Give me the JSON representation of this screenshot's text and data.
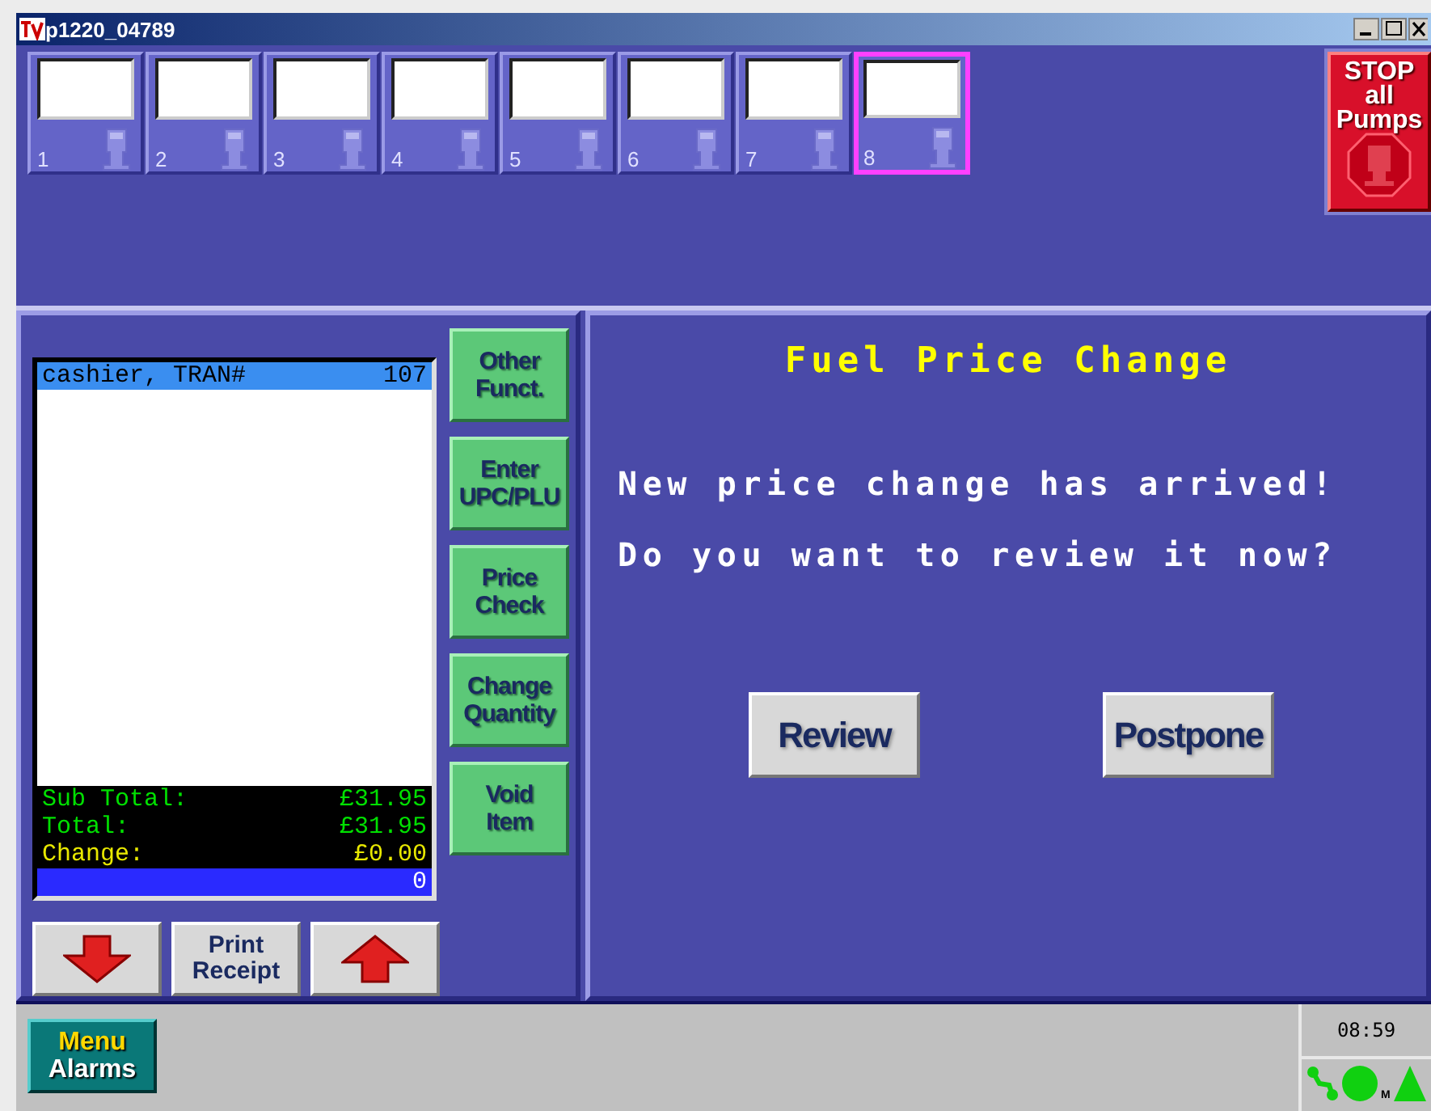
{
  "window": {
    "title": "p1220_04789"
  },
  "pumps": [
    {
      "label": "1",
      "selected": false
    },
    {
      "label": "2",
      "selected": false
    },
    {
      "label": "3",
      "selected": false
    },
    {
      "label": "4",
      "selected": false
    },
    {
      "label": "5",
      "selected": false
    },
    {
      "label": "6",
      "selected": false
    },
    {
      "label": "7",
      "selected": false
    },
    {
      "label": "8",
      "selected": true
    }
  ],
  "stop_button": {
    "label": "STOP\nall\nPumps"
  },
  "receipt": {
    "header": {
      "label": "cashier, TRAN#",
      "value": "107"
    },
    "totals": [
      {
        "kind": "total",
        "label": "Sub Total:",
        "value": "£31.95"
      },
      {
        "kind": "total",
        "label": "Total:",
        "value": "£31.95"
      },
      {
        "kind": "change",
        "label": "Change:",
        "value": "£0.00"
      }
    ],
    "entry": "0"
  },
  "function_buttons": [
    "Other\nFunct.",
    "Enter\nUPC/PLU",
    "Price\nCheck",
    "Change\nQuantity",
    "Void\nItem"
  ],
  "nav_buttons": [
    {
      "kind": "down"
    },
    {
      "kind": "text",
      "label": "Print\nReceipt"
    },
    {
      "kind": "up"
    }
  ],
  "dialog": {
    "title": "Fuel Price Change",
    "messages": [
      "New price change has arrived!",
      "Do you want to review it now?"
    ],
    "buttons": [
      "Review",
      "Postpone"
    ]
  },
  "bottom_bar": {
    "menu_button": [
      "Menu",
      "Alarms"
    ],
    "clock": "08:59",
    "status_mark": "M"
  }
}
